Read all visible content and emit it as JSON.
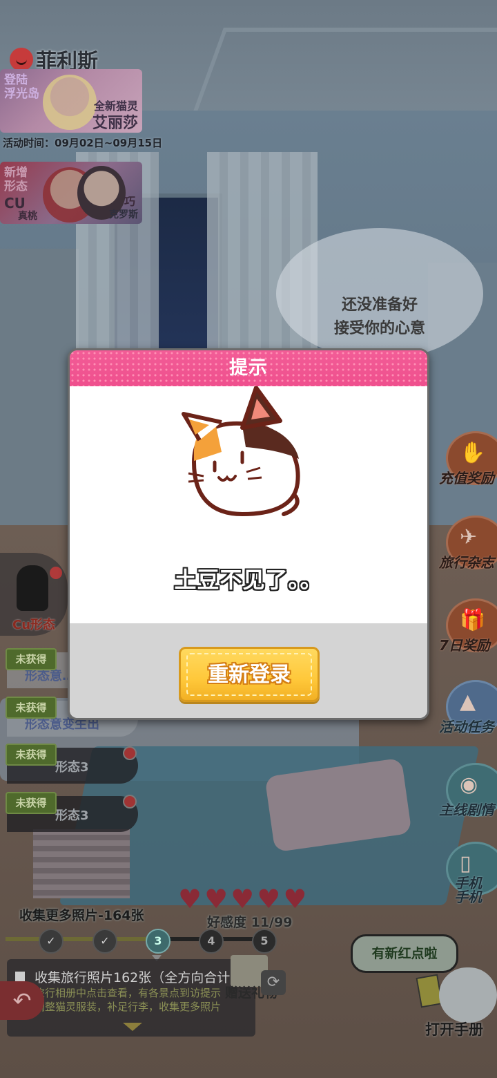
{
  "character": {
    "name": "菲利斯"
  },
  "banners": [
    {
      "tag": "登陆\n浮光岛",
      "subtitle": "全新猫灵",
      "title": "艾丽莎"
    },
    {
      "tag": "新增\n形态",
      "cu": "CU",
      "left_name": "真桃",
      "right_small": "巧",
      "right_name": "克罗斯"
    }
  ],
  "event_time": "活动时间：09月02日~09月15日",
  "speech": {
    "line1": "还没准备好",
    "line2": "接受你的心意"
  },
  "right_menu": [
    {
      "label": "充值奖励",
      "icon": "gift-hand-icon",
      "style": "orange"
    },
    {
      "label": "旅行杂志",
      "icon": "airplane-icon",
      "style": "orange"
    },
    {
      "label": "7日奖励",
      "icon": "gift-box-icon",
      "style": "orange"
    },
    {
      "label": "活动任务",
      "icon": "mountain-flag-icon",
      "style": "blue"
    },
    {
      "label": "主线剧情",
      "icon": "film-reel-icon",
      "style": "teal"
    },
    {
      "label": "手机\n手机",
      "icon": "phone-icon",
      "style": "teal"
    }
  ],
  "cu_form": {
    "label": "Cu形态"
  },
  "forms": [
    {
      "badge": "未获得",
      "name": "形态意…"
    },
    {
      "badge": "未获得",
      "name": "形态意变生出"
    },
    {
      "badge": "未获得",
      "name": "形态3"
    },
    {
      "badge": "未获得",
      "name": "形态3"
    }
  ],
  "progress": {
    "collect_more": "收集更多照片-164张",
    "favor_label": "好感度 11/99",
    "hearts_filled": 5,
    "hearts_total": 5,
    "nodes": [
      {
        "label": "✓",
        "state": "done"
      },
      {
        "label": "✓",
        "state": "done"
      },
      {
        "label": "3",
        "state": "current"
      },
      {
        "label": "4",
        "state": "locked"
      },
      {
        "label": "5",
        "state": "locked"
      }
    ]
  },
  "quest": {
    "line1": "收集旅行照片162张（全方向合计）",
    "line2": "旅行相册中点击查看，有各景点到访提示",
    "line3": "调整猫灵服装，补足行李，收集更多照片"
  },
  "gift_label": "赠送礼物",
  "new_red_dot": "有新红点啦",
  "handbook_label": "打开手册",
  "dialog": {
    "title": "提示",
    "message": "土豆不见了。。",
    "button": "重新登录"
  },
  "colors": {
    "dialog_header": "#ef4f8d",
    "button": "#ffc83a",
    "button_border": "#d89a1d"
  }
}
